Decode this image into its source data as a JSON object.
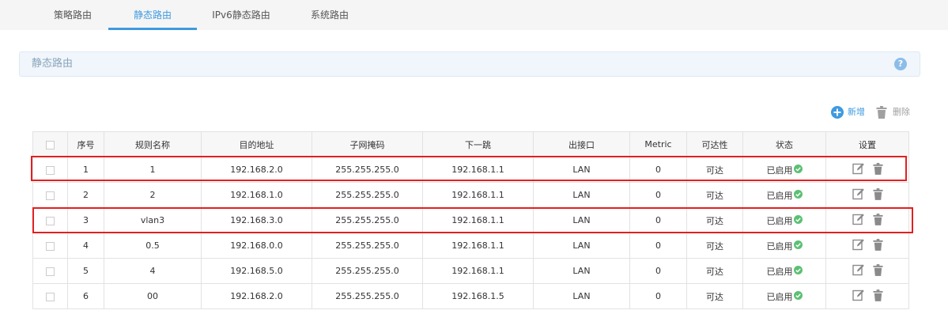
{
  "tabs": [
    {
      "label": "策略路由",
      "active": false
    },
    {
      "label": "静态路由",
      "active": true
    },
    {
      "label": "IPv6静态路由",
      "active": false
    },
    {
      "label": "系统路由",
      "active": false
    }
  ],
  "section": {
    "title": "静态路由",
    "help": "?"
  },
  "actions": {
    "add_label": "新增",
    "delete_label": "删除"
  },
  "colors": {
    "accent": "#3f9ae0",
    "status_ok": "#5cc074",
    "highlight": "#e12020"
  },
  "table": {
    "columns": [
      "序号",
      "规则名称",
      "目的地址",
      "子网掩码",
      "下一跳",
      "出接口",
      "Metric",
      "可达性",
      "状态",
      "设置"
    ],
    "rows": [
      {
        "index": "1",
        "name": "1",
        "dest": "192.168.2.0",
        "mask": "255.255.255.0",
        "next_hop": "192.168.1.1",
        "interface": "LAN",
        "metric": "0",
        "reachability": "可达",
        "status": "已启用"
      },
      {
        "index": "2",
        "name": "2",
        "dest": "192.168.1.0",
        "mask": "255.255.255.0",
        "next_hop": "192.168.1.1",
        "interface": "LAN",
        "metric": "0",
        "reachability": "可达",
        "status": "已启用"
      },
      {
        "index": "3",
        "name": "vlan3",
        "dest": "192.168.3.0",
        "mask": "255.255.255.0",
        "next_hop": "192.168.1.1",
        "interface": "LAN",
        "metric": "0",
        "reachability": "可达",
        "status": "已启用"
      },
      {
        "index": "4",
        "name": "0.5",
        "dest": "192.168.0.0",
        "mask": "255.255.255.0",
        "next_hop": "192.168.1.1",
        "interface": "LAN",
        "metric": "0",
        "reachability": "可达",
        "status": "已启用"
      },
      {
        "index": "5",
        "name": "4",
        "dest": "192.168.5.0",
        "mask": "255.255.255.0",
        "next_hop": "192.168.1.1",
        "interface": "LAN",
        "metric": "0",
        "reachability": "可达",
        "status": "已启用"
      },
      {
        "index": "6",
        "name": "00",
        "dest": "192.168.2.0",
        "mask": "255.255.255.0",
        "next_hop": "192.168.1.5",
        "interface": "LAN",
        "metric": "0",
        "reachability": "可达",
        "status": "已启用"
      }
    ]
  },
  "icons": {
    "help": "question-circle-icon",
    "add": "plus-circle-icon",
    "delete": "trash-icon",
    "edit": "edit-icon",
    "status_ok": "check-circle-icon"
  }
}
